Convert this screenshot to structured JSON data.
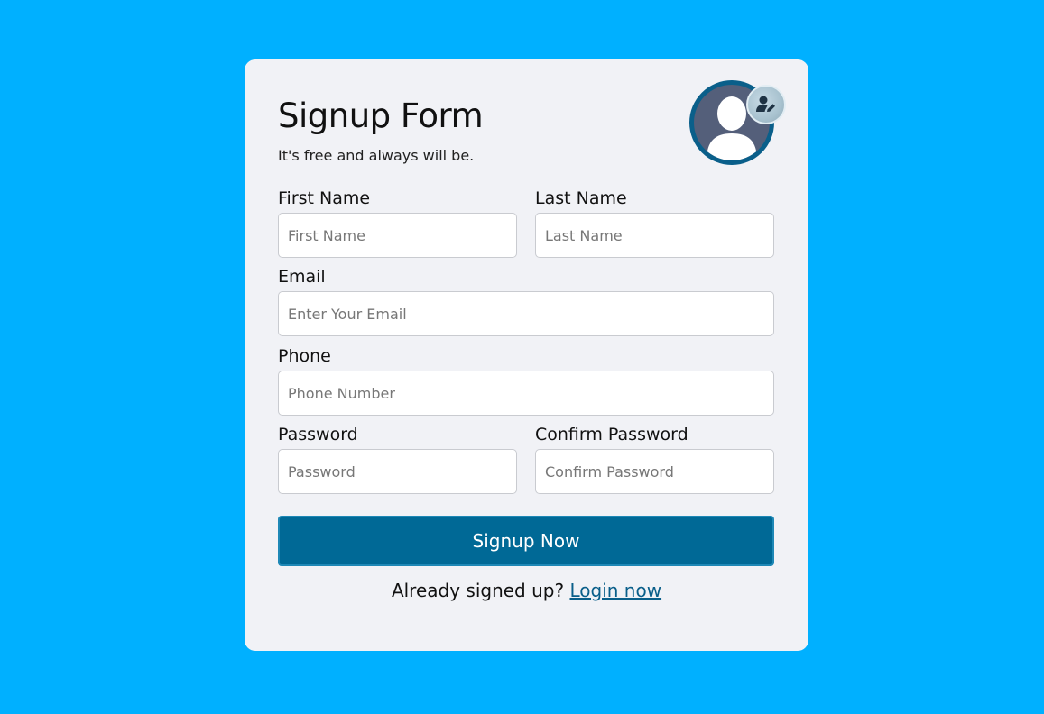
{
  "form": {
    "title": "Signup Form",
    "subtitle": "It's free and always will be.",
    "fields": {
      "first_name": {
        "label": "First Name",
        "placeholder": "First Name",
        "value": ""
      },
      "last_name": {
        "label": "Last Name",
        "placeholder": "Last Name",
        "value": ""
      },
      "email": {
        "label": "Email",
        "placeholder": "Enter Your Email",
        "value": ""
      },
      "phone": {
        "label": "Phone",
        "placeholder": "Phone Number",
        "value": ""
      },
      "password": {
        "label": "Password",
        "placeholder": "Password",
        "value": ""
      },
      "confirm_password": {
        "label": "Confirm Password",
        "placeholder": "Confirm Password",
        "value": ""
      }
    },
    "submit_label": "Signup Now",
    "footer_text": "Already signed up?",
    "login_link": "Login now"
  },
  "icons": {
    "avatar": "user-silhouette-icon",
    "avatar_edit": "user-edit-icon"
  },
  "colors": {
    "background": "#00b0ff",
    "card": "#f1f2f6",
    "button": "#006996",
    "link": "#0a5f8a",
    "avatar_ring": "#0a5f8a",
    "avatar_fill": "#545f7a"
  }
}
